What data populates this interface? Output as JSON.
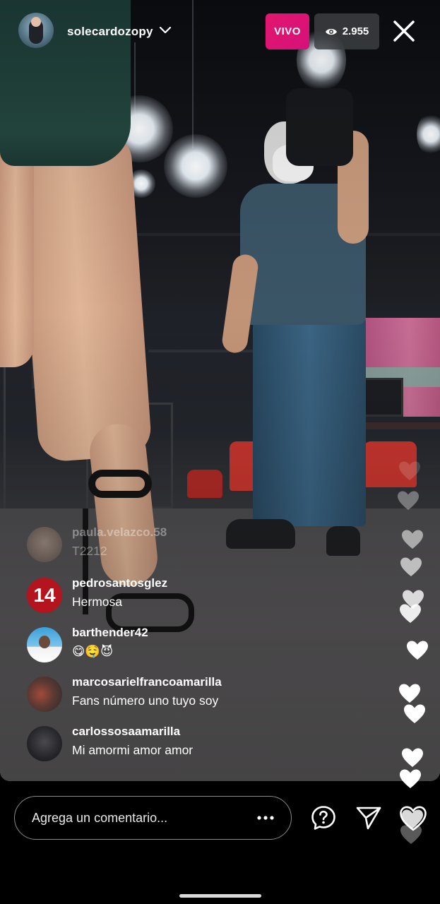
{
  "header": {
    "username": "solecardozopy",
    "live_label": "VIVO",
    "viewer_count": "2.955"
  },
  "comments": [
    {
      "user": "paula.velazco.58",
      "text": "T2212",
      "faded": true
    },
    {
      "user": "pedrosantosglez",
      "text": "Hermosa"
    },
    {
      "user": "barthender42",
      "text": "😋🤤😈"
    },
    {
      "user": "marcosarielfrancoamarilla",
      "text": "Fans número uno tuyo soy"
    },
    {
      "user": "carlossosaamarilla",
      "text": "Mi amormi amor amor"
    }
  ],
  "comment_badges": {
    "pedrosantosglez_jersey_number": "14"
  },
  "bottom_bar": {
    "comment_placeholder": "Agrega un comentario..."
  },
  "icons": {
    "chevron": "chevron-down-icon",
    "viewers": "eye-icon",
    "close": "close-icon",
    "more": "more-dots-icon",
    "question": "question-icon",
    "send": "send-icon",
    "like": "heart-icon"
  },
  "colors": {
    "live_badge": "#e0186e",
    "viewer_badge": "#3c3e42",
    "background": "#000000"
  }
}
